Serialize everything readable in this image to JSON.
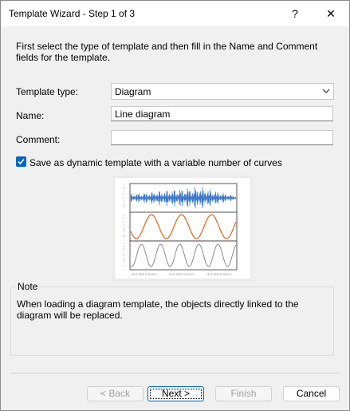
{
  "window": {
    "title": "Template Wizard - Step 1 of 3",
    "help_label": "?",
    "close_label": "✕"
  },
  "intro_text": "First select the type of template and then fill in the Name and Comment fields for the template.",
  "form": {
    "template_type_label": "Template type:",
    "template_type_value": "Diagram",
    "name_label": "Name:",
    "name_value": "Line diagram",
    "comment_label": "Comment:",
    "comment_value": "",
    "dynamic_checkbox_label": "Save as dynamic template with a variable number of curves",
    "dynamic_checked": true
  },
  "preview": {
    "x_tick_labels": [
      "16.11.2005 11:00:00.0",
      "16.11.2005 11:00:00.0",
      "16.11.2005 11:00:00.0"
    ],
    "colors": {
      "blue": "#3c78c8",
      "orange": "#e2611a",
      "gray": "#808080"
    }
  },
  "note": {
    "title": "Note",
    "text": "When loading a diagram template, the objects directly linked to the diagram will be replaced."
  },
  "buttons": {
    "back": "< Back",
    "next": "Next >",
    "finish": "Finish",
    "cancel": "Cancel"
  },
  "colors": {
    "accent": "#0067c0"
  }
}
